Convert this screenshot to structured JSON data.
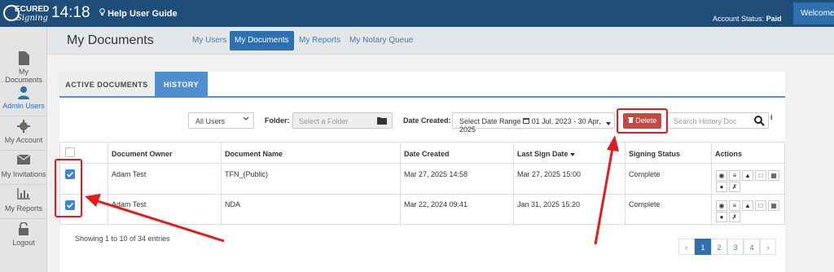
{
  "topbar": {
    "logo_top": "ECURED",
    "logo_bottom": "Signing",
    "clock": "14:18",
    "help": "Help User Guide",
    "account_label": "Account Status:",
    "account_value": "Paid",
    "welcome": "Welcome,"
  },
  "sidebar": {
    "items": [
      {
        "label": "My Documents",
        "icon": "file-icon"
      },
      {
        "label": "Admin Users",
        "icon": "user-icon"
      },
      {
        "label": "My Account",
        "icon": "gear-icon"
      },
      {
        "label": "My Invitations",
        "icon": "envelope-icon"
      },
      {
        "label": "My Reports",
        "icon": "bar-chart-icon"
      },
      {
        "label": "Logout",
        "icon": "unlock-icon"
      }
    ]
  },
  "header": {
    "title": "My Documents",
    "nav": [
      "My Users",
      "My Documents",
      "My Reports",
      "My Notary Queue"
    ]
  },
  "tabs": [
    "ACTIVE DOCUMENTS",
    "HISTORY"
  ],
  "filters": {
    "users": "All Users",
    "folder_label": "Folder:",
    "folder_placeholder": "Select a Folder",
    "date_label": "Date Created:",
    "date_range_label": "Select Date Range",
    "date_range_value": "01 Jul, 2023 - 30 Apr, 2025",
    "delete": "Delete",
    "search_placeholder": "Search History Doc",
    "info": "i"
  },
  "table": {
    "columns": [
      "Document Owner",
      "Document Name",
      "Date Created",
      "Last Sign Date",
      "Signing Status",
      "Actions"
    ],
    "rows": [
      {
        "owner": "Adam Test",
        "name": "TFN_(Public)",
        "created": "Mar 27, 2025 14:58",
        "last_sign": "Mar 27, 2025 15:00",
        "status": "Complete",
        "checked": true
      },
      {
        "owner": "Adam Test",
        "name": "NDA",
        "created": "Mar 22, 2024 09:41",
        "last_sign": "Jan 31, 2025 15:20",
        "status": "Complete",
        "checked": true
      }
    ]
  },
  "footer": {
    "showing": "Showing 1 to 10 of 34 entries",
    "pages": [
      "‹",
      "1",
      "2",
      "3",
      "4",
      "›"
    ],
    "current_page": "1"
  },
  "colors": {
    "topbar": "#1f4d7a",
    "accent": "#2e6fb0",
    "delete": "#c9473d",
    "annotation": "#e31b1b"
  }
}
